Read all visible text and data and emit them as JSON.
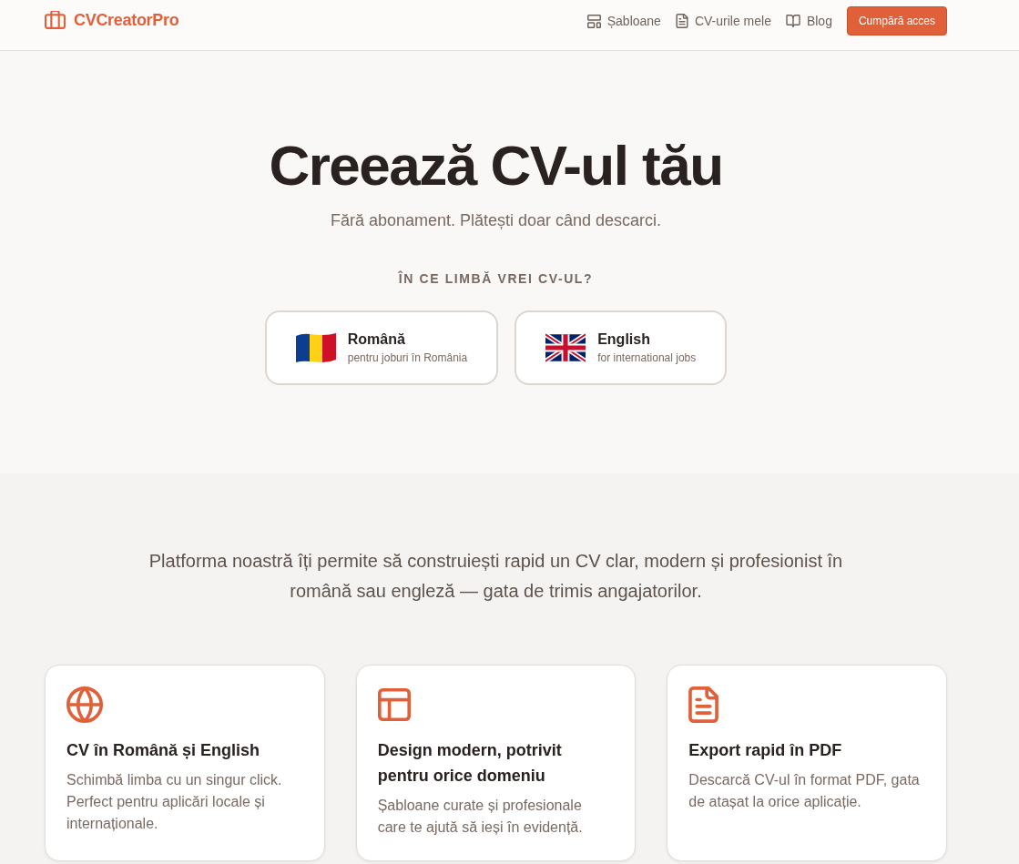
{
  "header": {
    "brand": "CVCreatorPro",
    "nav": [
      "Șabloane",
      "CV-urile mele",
      "Blog"
    ],
    "cta": "Cumpără acces"
  },
  "hero": {
    "title": "Creează CV-ul tău",
    "subtitle": "Fără abonament. Plătești doar când descarci.",
    "question": "ÎN CE LIMBĂ VREI CV-UL?",
    "languages": [
      {
        "name": "Română",
        "note": "pentru joburi în România"
      },
      {
        "name": "English",
        "note": "for international jobs"
      }
    ]
  },
  "about": {
    "text": "Platforma noastră îți permite să construiești rapid un CV clar, modern și profesionist în română sau engleză — gata de trimis angajatorilor.",
    "features": [
      {
        "title": "CV în Română și English",
        "description": "Schimbă limba cu un singur click. Perfect pentru aplicări locale și internaționale."
      },
      {
        "title": "Design modern, potrivit pentru orice domeniu",
        "description": "Șabloane curate și profesionale care te ajută să ieși în evidență."
      },
      {
        "title": "Export rapid în PDF",
        "description": "Descarcă CV-ul în format PDF, gata de atașat la orice aplicație."
      }
    ]
  }
}
